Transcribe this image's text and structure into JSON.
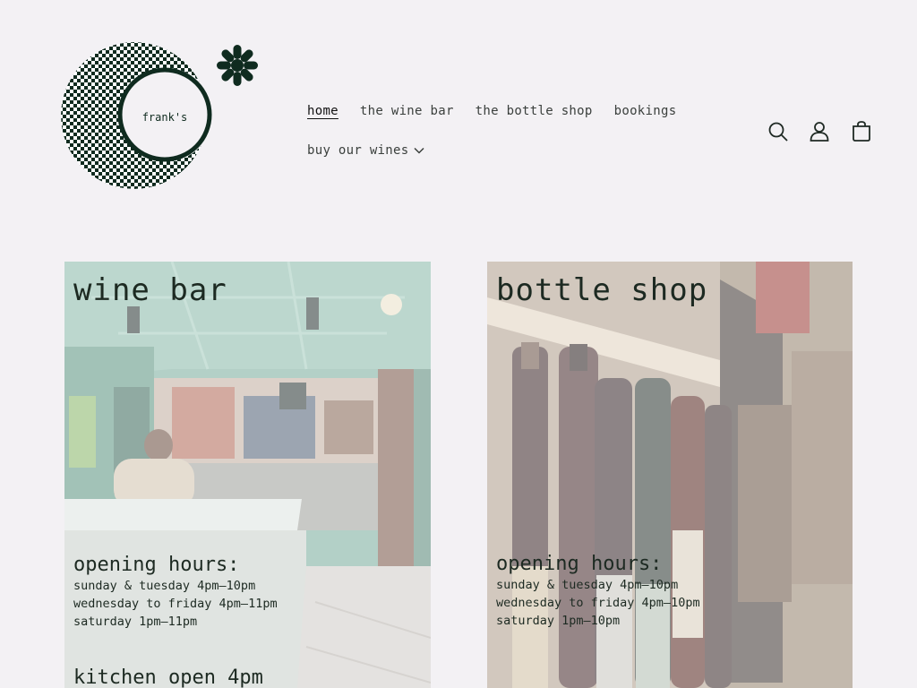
{
  "brand": {
    "logo_text": "frank's"
  },
  "nav": {
    "items": [
      {
        "label": "home",
        "active": true
      },
      {
        "label": "the wine bar"
      },
      {
        "label": "the bottle shop"
      },
      {
        "label": "bookings"
      }
    ],
    "dropdown": {
      "label": "buy our wines"
    }
  },
  "header_icons": [
    "search-icon",
    "account-icon",
    "cart-icon"
  ],
  "wine_bar": {
    "title": "wine bar",
    "hours_heading": "opening hours:",
    "hours": [
      "sunday & tuesday 4pm–10pm",
      "wednesday to friday 4pm–11pm",
      "saturday 1pm–11pm"
    ],
    "kitchen": "kitchen open 4pm"
  },
  "bottle_shop": {
    "title": "bottle shop",
    "hours_heading": "opening hours:",
    "hours": [
      "sunday & tuesday 4pm–10pm",
      "wednesday to friday 4pm–10pm",
      "saturday 1pm–10pm"
    ]
  },
  "colors": {
    "background": "#f3f1f4",
    "brand_green": "#0f2b1f"
  }
}
